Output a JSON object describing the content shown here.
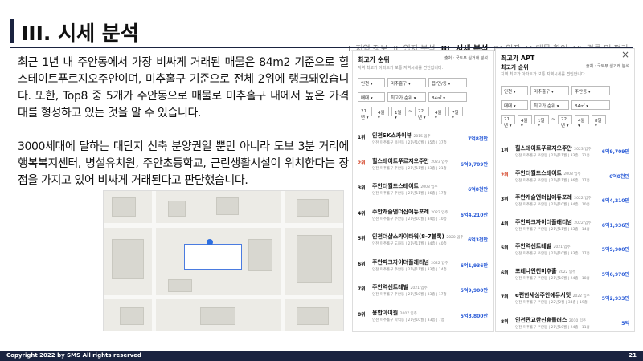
{
  "slide": {
    "title": "III. 시세 분석",
    "page_number": "21",
    "copyright": "Copyright 2022 by SMS All rights reserved"
  },
  "nav": [
    "I. 지역 정보",
    "II. 입지 분석",
    "III. 시세 분석",
    "IV. 임장",
    "V. 매물 확인",
    "VI. 결론 및 평가"
  ],
  "nav_active": 2,
  "body": {
    "para1": "최근 1년 내 주안동에서 가장 비싸게 거래된 매물은 84m2 기준으로 힐스테이트푸르지오주안이며, 미추홀구 기준으로 전체 2위에 랭크돼있습니다. 또한, Top8 중 5개가 주안동으로 매물로 미추홀구 내에서 높은 가격대를 형성하고 있는 것을 알 수 있습니다.",
    "para2": "3000세대에 달하는 대단지 신축 분양권일 뿐만 아니라 도보 3분 거리에 행복복지센터, 병설유치원, 주안초등학교, 근린생활시설이 위치한다는 장점을 가지고 있어 비싸게 거래된다고 판단했습니다."
  },
  "panel_a": {
    "header": "최고가 순위",
    "source": "출처 : 국토부 실거래 분석",
    "desc": "지역 최고가 아파트가 보통 지역시세를 견인합니다.",
    "filters": [
      "인천",
      "미추홀구",
      "읍/면/동",
      "매매",
      "최고가 순위",
      "84㎡",
      "21년",
      "4월",
      "1일",
      "~",
      "22년",
      "4월",
      "7일"
    ],
    "items": [
      {
        "rank": "1위",
        "name": "인천SK스카이뷰",
        "year": "2015 입주",
        "sub": "인천 미추홀구 용현동 | 21년10월 | 35층 | 37층",
        "price": "7억8천만"
      },
      {
        "rank": "2위",
        "name": "힐스테이트푸르지오주안",
        "year": "2023 입주",
        "sub": "인천 미추홀구 주안동 | 21년11월 | 33층 | 21층",
        "price": "6억9,709만"
      },
      {
        "rank": "3위",
        "name": "주안더월드스테이트",
        "year": "2008 입주",
        "sub": "인천 미추홀구 주안동 | 21년11월 | 36층 | 17층",
        "price": "6억8천만"
      },
      {
        "rank": "4위",
        "name": "주안캐슬앤더샵에듀포레",
        "year": "2022 입주",
        "sub": "인천 미추홀구 주안동 | 21년10월 | 34층 | 10층",
        "price": "6억4,210만"
      },
      {
        "rank": "5위",
        "name": "인천더샵스카이타워(8-7블록)",
        "year": "2020 입주",
        "sub": "인천 미추홀구 도화동 | 21년11월 | 34층 | 40층",
        "price": "6억3천만"
      },
      {
        "rank": "6위",
        "name": "주안파크자이더플래티넘",
        "year": "2022 입주",
        "sub": "인천 미추홀구 주안동 | 21년11월 | 33층 | 14층",
        "price": "6억1,936만"
      },
      {
        "rank": "7위",
        "name": "주안역센트레빌",
        "year": "2021 입주",
        "sub": "인천 미추홀구 주안동 | 21년10월 | 33층 | 17층",
        "price": "5억9,900만"
      },
      {
        "rank": "8위",
        "name": "용합아이원",
        "year": "2007 입주",
        "sub": "인천 미추홀구 학익동 | 21년10월 | 33층 | 7층",
        "price": "5억8,800만"
      }
    ]
  },
  "panel_b": {
    "header": "최고가 APT",
    "subheader": "최고가 순위",
    "source": "출처 : 국토부 실거래 분석",
    "desc": "지역 최고가 아파트가 보통 지역시세를 견인합니다.",
    "filters": [
      "인천",
      "미추홀구",
      "주안동",
      "매매",
      "최고가 순위",
      "84㎡",
      "21년",
      "4월",
      "1일",
      "~",
      "22년",
      "4월",
      "8일"
    ],
    "items": [
      {
        "rank": "1위",
        "name": "힐스테이트푸르지오주안",
        "year": "2023 입주",
        "sub": "인천 미추홀구 주안동 | 21년11월 | 33층 | 21층",
        "price": "6억9,709만"
      },
      {
        "rank": "2위",
        "name": "주안더월드스테이트",
        "year": "2008 입주",
        "sub": "인천 미추홀구 주안동 | 21년11월 | 36층 | 17층",
        "price": "6억8천만"
      },
      {
        "rank": "3위",
        "name": "주안캐슬앤더샵에듀포레",
        "year": "2022 입주",
        "sub": "인천 미추홀구 주안동 | 21년10월 | 34층 | 10층",
        "price": "6억4,210만"
      },
      {
        "rank": "4위",
        "name": "주안파크자이더플래티넘",
        "year": "2022 입주",
        "sub": "인천 미추홀구 주안동 | 21년11월 | 33층 | 14층",
        "price": "6억1,936만"
      },
      {
        "rank": "5위",
        "name": "주안역센트레빌",
        "year": "2021 입주",
        "sub": "인천 미추홀구 주안동 | 21년10월 | 33층 | 17층",
        "price": "5억9,900만"
      },
      {
        "rank": "6위",
        "name": "포레나인천미추홀",
        "year": "2022 입주",
        "sub": "인천 미추홀구 주안동 | 21년10월 | 24층 | 18층",
        "price": "5억6,970만"
      },
      {
        "rank": "7위",
        "name": "e편한세상주안에듀서밋",
        "year": "2022 입주",
        "sub": "인천 미추홀구 주안동 | 22년2월 | 34층 | 19층",
        "price": "5억2,933만"
      },
      {
        "rank": "8위",
        "name": "인천관교한신휴플러스",
        "year": "2010 입주",
        "sub": "인천 미추홀구 주안동 | 21년10월 | 24층 | 11층",
        "price": "5억"
      }
    ]
  }
}
